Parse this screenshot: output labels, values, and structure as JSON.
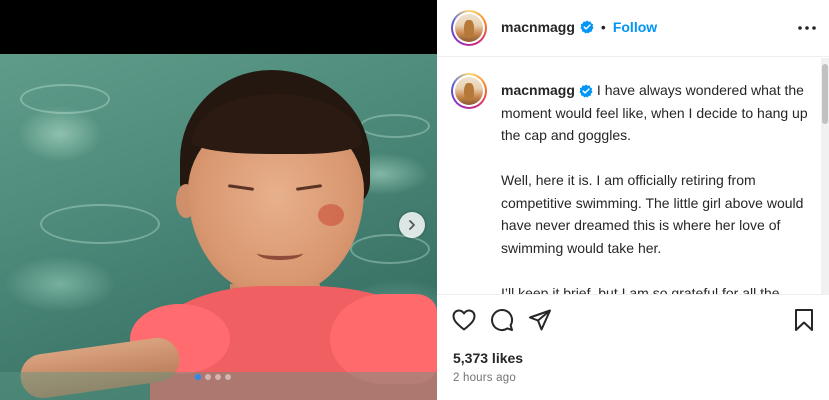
{
  "post": {
    "author": "macnmagg",
    "follow_label": "Follow",
    "separator": "•",
    "caption_paragraphs": [
      "I have always wondered what the moment would feel like, when I decide to hang up the cap and goggles.",
      "Well, here it is. I am officially retiring from competitive swimming. The little girl above would have never dreamed this is where her love of swimming would take her.",
      "I’ll keep it brief, but I am so grateful for all the memories, people, and places I have gotten to experience just through swimming. Anyone who I"
    ],
    "likes": "5,373 likes",
    "time": "2 hours ago"
  },
  "carousel": {
    "total": 4,
    "active": 0
  },
  "icons": {
    "verified": "verified-badge-icon",
    "more": "more-options-icon",
    "like": "heart-icon",
    "comment": "comment-icon",
    "share": "paper-plane-icon",
    "save": "bookmark-icon",
    "next": "chevron-right-icon"
  },
  "colors": {
    "link": "#0095f6",
    "verified": "#0095f6",
    "carousel_active": "#2b8bf2",
    "muted": "#737373"
  }
}
